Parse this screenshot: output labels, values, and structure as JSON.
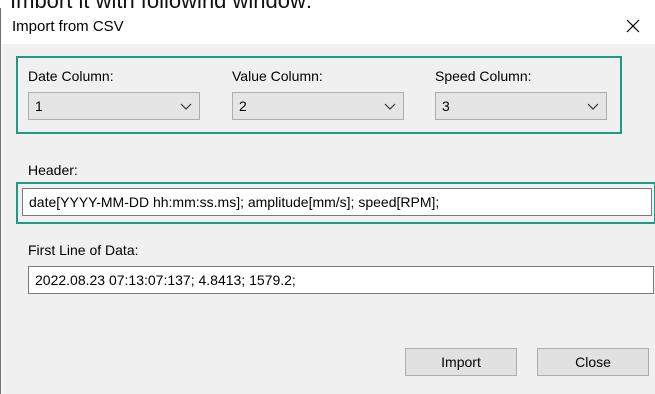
{
  "context_text": "Import it with following window:",
  "window": {
    "title": "Import from CSV",
    "close_glyph": "✕"
  },
  "columns": {
    "date": {
      "label": "Date Column:",
      "value": "1"
    },
    "value": {
      "label": "Value Column:",
      "value": "2"
    },
    "speed": {
      "label": "Speed Column:",
      "value": "3"
    }
  },
  "header": {
    "label": "Header:",
    "value": "date[YYYY-MM-DD hh:mm:ss.ms]; amplitude[mm/s]; speed[RPM];"
  },
  "first_line": {
    "label": "First Line of Data:",
    "value": "2022.08.23 07:13:07:137; 4.8413; 1579.2;"
  },
  "buttons": {
    "import": "Import",
    "close": "Close"
  },
  "colors": {
    "highlight": "#1e9c82",
    "dialog_bg": "#f0f0f0"
  }
}
